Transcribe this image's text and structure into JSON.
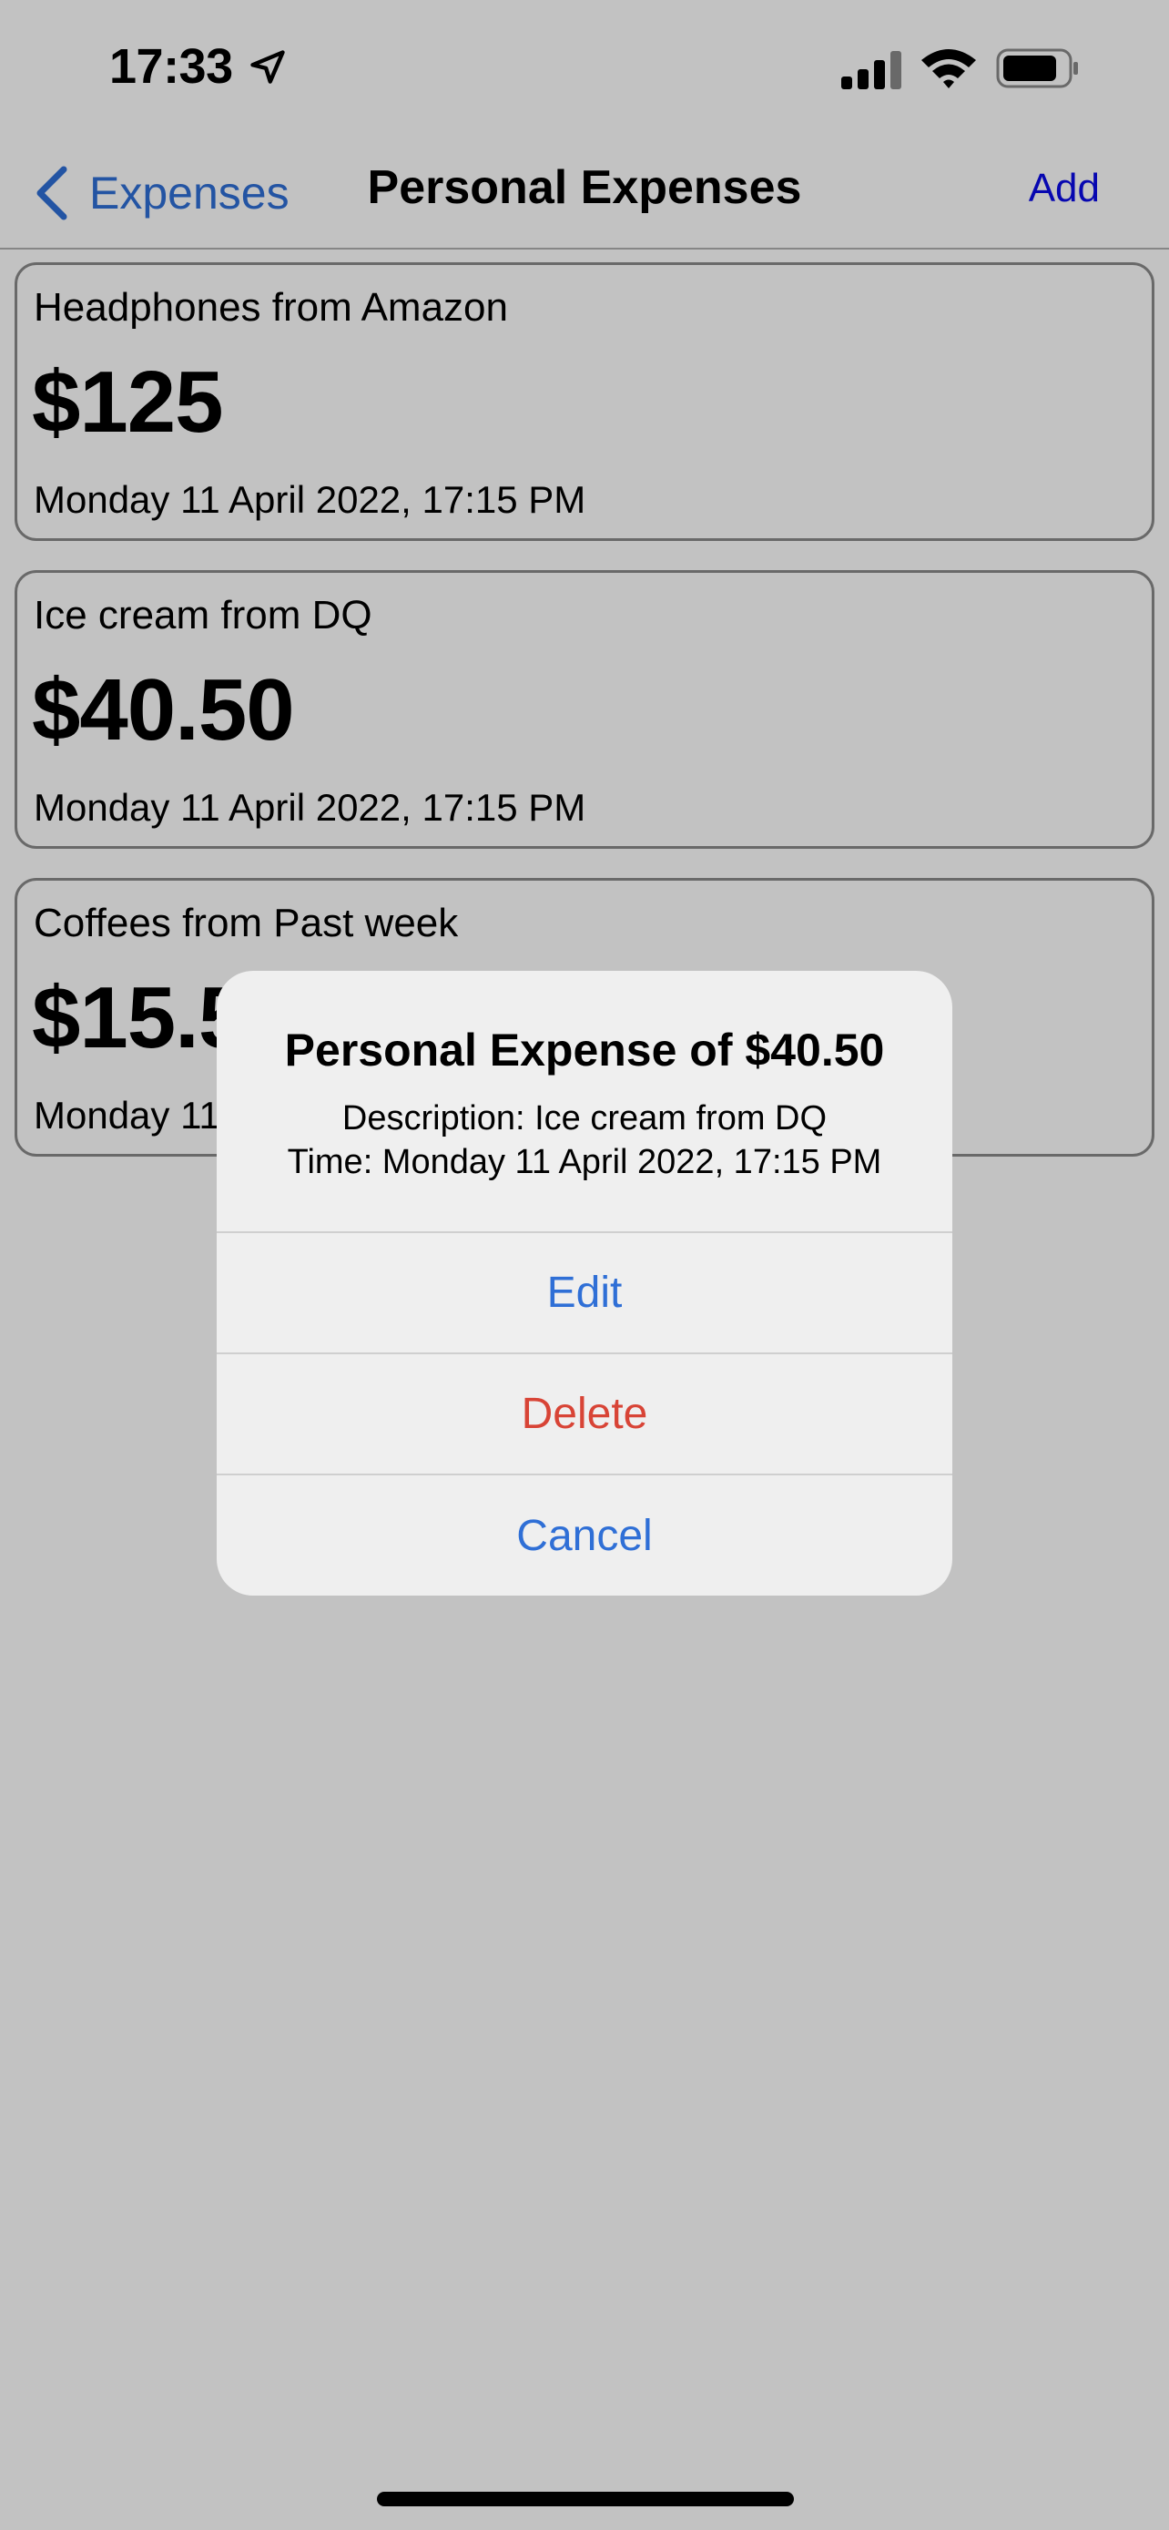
{
  "status_bar": {
    "time": "17:33",
    "location_icon": "location-arrow-icon",
    "signal_icon": "cellular-signal-icon",
    "wifi_icon": "wifi-icon",
    "battery_icon": "battery-icon"
  },
  "nav": {
    "back_label": "Expenses",
    "back_icon": "chevron-left-icon",
    "title": "Personal Expenses",
    "add_label": "Add"
  },
  "expenses": [
    {
      "description": "Headphones from Amazon",
      "amount": "$125",
      "time": "Monday 11 April 2022, 17:15 PM"
    },
    {
      "description": "Ice cream from DQ",
      "amount": "$40.50",
      "time": "Monday 11 April 2022, 17:15 PM"
    },
    {
      "description": "Coffees from Past week",
      "amount": "$15.50",
      "time": "Monday 11 April 2022, 17:15 PM"
    }
  ],
  "alert": {
    "title": "Personal Expense of $40.50",
    "description": "Description: Ice cream from DQ",
    "time": "Time: Monday 11 April 2022, 17:15 PM",
    "actions": {
      "edit": "Edit",
      "delete": "Delete",
      "cancel": "Cancel"
    }
  },
  "colors": {
    "accent": "#2f6fd6",
    "destructive": "#d84436",
    "add_link": "#0a0ae8"
  }
}
